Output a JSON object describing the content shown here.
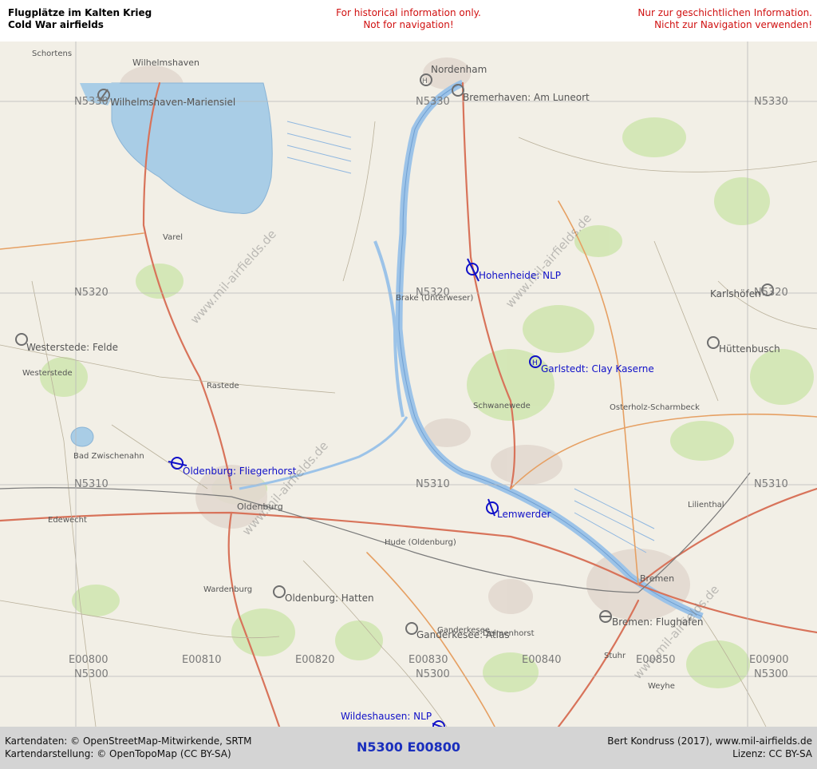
{
  "header": {
    "title_de": "Flugplätze im Kalten Krieg",
    "title_en": "Cold War airfields",
    "warning_en_1": "For historical information only.",
    "warning_en_2": "Not for navigation!",
    "warning_de_1": "Nur zur geschichtlichen Information.",
    "warning_de_2": "Nicht zur Navigation verwenden!"
  },
  "grid": {
    "n5330_a": "N5330",
    "n5330_b": "N5330",
    "n5330_c": "N5330",
    "n5320_a": "N5320",
    "n5320_b": "N5320",
    "n5320_c": "N5320",
    "n5310_a": "N5310",
    "n5310_b": "N5310",
    "n5310_c": "N5310",
    "e00800": "E00800",
    "e00810": "E00810",
    "e00820": "E00820",
    "e00830": "E00830",
    "e00840": "E00840",
    "e00850": "E00850",
    "e00900": "E00900",
    "n5300_a": "N5300",
    "n5300_b": "N5300",
    "n5300_c": "N5300"
  },
  "airfields": {
    "wilhelmshaven": "Wilhelmshaven-Mariensiel",
    "bremerhaven": "Bremerhaven: Am Luneort",
    "hohenheide": "Hohenheide: NLP",
    "karlshoefen": "Karlshöfen",
    "westerstede": "Westerstede: Felde",
    "garlstedt": "Garlstedt: Clay Kaserne",
    "huettenbusch": "Hüttenbusch",
    "oldenburg_fh": "Oldenburg: Fliegerhorst",
    "lemwerder": "Lemwerder",
    "oldenburg_hatten": "Oldenburg: Hatten",
    "ganderkesee": "Ganderkesee: Atlas",
    "bremen": "Bremen: Flughafen",
    "wildeshausen": "Wildeshausen: NLP"
  },
  "towns": {
    "wilhelmshaven": "Wilhelmshaven",
    "nordenham": "Nordenham",
    "oldenburg": "Oldenburg",
    "bremen": "Bremen",
    "delmenhorst": "Delmenhorst",
    "varel": "Varel",
    "rastede": "Rastede",
    "brake": "Brake (Unterweser)",
    "schwanewede": "Schwanewede",
    "osterholz": "Osterholz-Scharmbeck",
    "ganderkesee": "Ganderkesee",
    "hude": "Hude (Oldenburg)",
    "wardenburg": "Wardenburg",
    "westerstede": "Westerstede",
    "bad_zwischenahn": "Bad Zwischenahn",
    "stuhr": "Stuhr",
    "weyhe": "Weyhe",
    "lilienthal": "Lilienthal",
    "edewecht": "Edewecht",
    "schortens": "Schortens"
  },
  "watermark": "www.mil-airfields.de",
  "footer": {
    "data_credit": "Kartendaten: © OpenStreetMap-Mitwirkende, SRTM",
    "render_credit": "Kartendarstellung: © OpenTopoMap (CC BY-SA)",
    "sheet": "N5300 E00800",
    "author": "Bert Kondruss (2017), www.mil-airfields.de",
    "license": "Lizenz: CC BY-SA"
  },
  "colors": {
    "sea": "#a9cde6",
    "river": "#9cc3e8",
    "land": "#f2efe6",
    "forest": "#c8e0a8",
    "airfield_active": "#1010c8",
    "airfield_inactive": "#6e6e6e",
    "header_warning": "#d01010",
    "footer_bg": "#d4d4d4",
    "sheet_label": "#1a2fbd"
  }
}
